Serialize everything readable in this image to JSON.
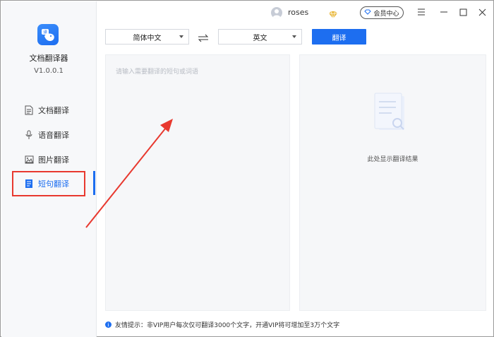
{
  "app": {
    "name": "文档翻译器",
    "version": "V1.0.0.1"
  },
  "sidebar": {
    "items": [
      {
        "label": "文档翻译",
        "icon": "document-icon"
      },
      {
        "label": "语音翻译",
        "icon": "microphone-icon"
      },
      {
        "label": "图片翻译",
        "icon": "image-icon"
      },
      {
        "label": "短句翻译",
        "icon": "short-sentence-icon"
      }
    ],
    "active_index": 3
  },
  "titlebar": {
    "username": "roses",
    "member_label": "会员中心"
  },
  "toolbar": {
    "source_lang": "简体中文",
    "target_lang": "英文",
    "translate_label": "翻译"
  },
  "input": {
    "placeholder": "请输入需要翻译的短句或词语"
  },
  "output": {
    "empty_text": "此处显示翻译结果"
  },
  "footer": {
    "tip": "友情提示：非VIP用户每次仅可翻译3000个文字，开通VIP将可增加至3万个文字"
  },
  "colors": {
    "accent": "#1d6ef0",
    "annotation": "#e8392f",
    "vip_gold": "#e9b83c"
  }
}
